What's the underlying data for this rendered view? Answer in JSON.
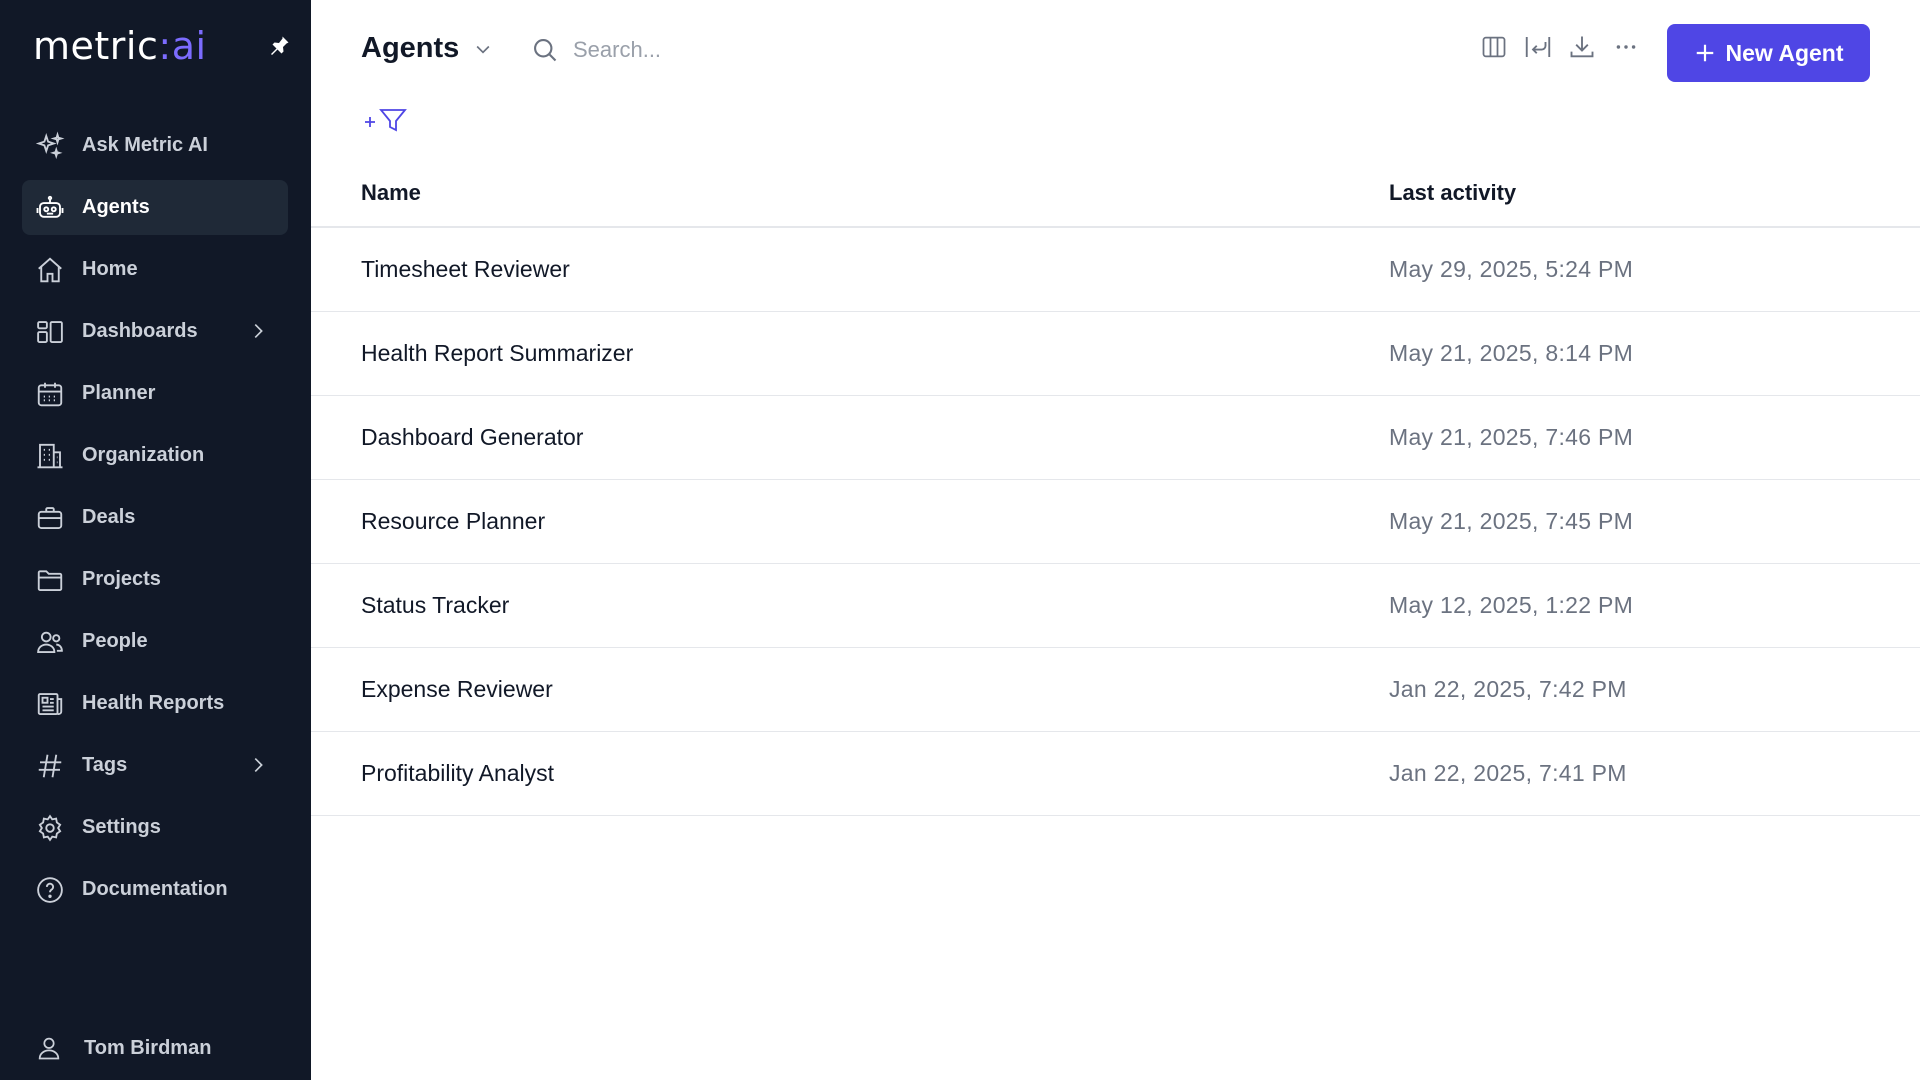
{
  "brand": {
    "name": "metric",
    "sep": ":",
    "suffix": "ai"
  },
  "sidebar": {
    "items": [
      {
        "label": "Ask Metric AI",
        "icon": "sparkles-icon"
      },
      {
        "label": "Agents",
        "icon": "robot-icon",
        "active": true
      },
      {
        "label": "Home",
        "icon": "home-icon"
      },
      {
        "label": "Dashboards",
        "icon": "dashboard-icon",
        "has_children": true
      },
      {
        "label": "Planner",
        "icon": "calendar-icon"
      },
      {
        "label": "Organization",
        "icon": "building-icon"
      },
      {
        "label": "Deals",
        "icon": "briefcase-icon"
      },
      {
        "label": "Projects",
        "icon": "folder-icon"
      },
      {
        "label": "People",
        "icon": "users-icon"
      },
      {
        "label": "Health Reports",
        "icon": "newspaper-icon"
      },
      {
        "label": "Tags",
        "icon": "hash-icon",
        "has_children": true
      },
      {
        "label": "Settings",
        "icon": "gear-icon"
      },
      {
        "label": "Documentation",
        "icon": "help-circle-icon"
      }
    ],
    "user": {
      "name": "Tom Birdman"
    }
  },
  "header": {
    "title": "Agents",
    "search_placeholder": "Search...",
    "new_button_label": "New Agent"
  },
  "table": {
    "columns": [
      "Name",
      "Last activity"
    ],
    "rows": [
      {
        "name": "Timesheet Reviewer",
        "last_activity": "May 29, 2025, 5:24 PM"
      },
      {
        "name": "Health Report Summarizer",
        "last_activity": "May 21, 2025, 8:14 PM"
      },
      {
        "name": "Dashboard Generator",
        "last_activity": "May 21, 2025, 7:46 PM"
      },
      {
        "name": "Resource Planner",
        "last_activity": "May 21, 2025, 7:45 PM"
      },
      {
        "name": "Status Tracker",
        "last_activity": "May 12, 2025, 1:22 PM"
      },
      {
        "name": "Expense Reviewer",
        "last_activity": "Jan 22, 2025, 7:42 PM"
      },
      {
        "name": "Profitability Analyst",
        "last_activity": "Jan 22, 2025, 7:41 PM"
      }
    ]
  },
  "colors": {
    "sidebar_bg": "#111827",
    "accent": "#4f46e5",
    "brand_accent": "#7c6cff"
  }
}
